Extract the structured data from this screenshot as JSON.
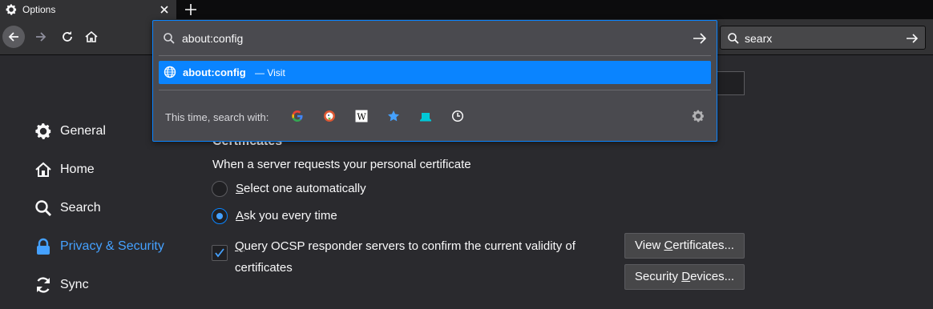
{
  "tab": {
    "title": "Options"
  },
  "searchbar": {
    "value": "searx"
  },
  "urlbar": {
    "value": "about:config",
    "result_title": "about:config",
    "result_action": "— Visit",
    "oneoff_label": "This time, search with:",
    "engines": [
      "google-icon",
      "duckduckgo-icon",
      "wikipedia-icon",
      "bookmarks-icon",
      "tabs-icon",
      "history-icon"
    ]
  },
  "sidebar": {
    "items": [
      {
        "label": "General",
        "icon": "gear-icon"
      },
      {
        "label": "Home",
        "icon": "home-icon"
      },
      {
        "label": "Search",
        "icon": "search-icon"
      },
      {
        "label": "Privacy & Security",
        "icon": "lock-icon"
      },
      {
        "label": "Sync",
        "icon": "sync-icon"
      }
    ]
  },
  "certificates": {
    "title": "Certificates",
    "description": "When a server requests your personal certificate",
    "option_auto_prefix": "S",
    "option_auto_rest": "elect one automatically",
    "option_ask_prefix": "A",
    "option_ask_rest": "sk you every time",
    "ocsp_prefix": "Q",
    "ocsp_rest": "uery OCSP responder servers to confirm the current validity of certificates",
    "view_prefix": "View ",
    "view_key": "C",
    "view_rest": "ertificates...",
    "devices_prefix": "Security ",
    "devices_key": "D",
    "devices_rest": "evices..."
  },
  "colors": {
    "accent": "#0a84ff",
    "active_link": "#45a1ff",
    "background": "#2a2a2e"
  }
}
